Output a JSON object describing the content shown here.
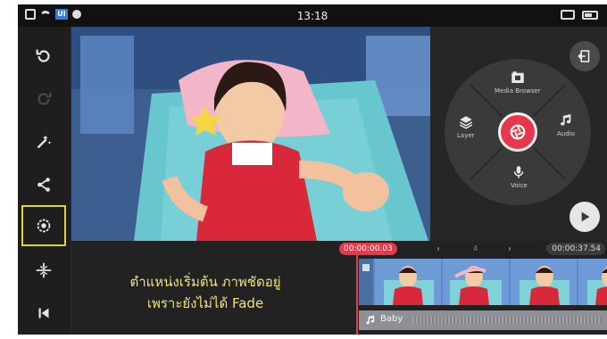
{
  "status_bar": {
    "time": "13:18",
    "badge": "UI",
    "left_icons": [
      "notification-icon",
      "wifi-icon",
      "app-badge-icon",
      "location-pin-icon"
    ],
    "right_icons": [
      "cast-icon",
      "battery-icon"
    ]
  },
  "toolbar": {
    "items": [
      {
        "name": "undo",
        "icon": "undo-icon",
        "enabled": true
      },
      {
        "name": "redo",
        "icon": "redo-icon",
        "enabled": false
      },
      {
        "name": "effects",
        "icon": "magic-wand-icon",
        "enabled": true
      },
      {
        "name": "share",
        "icon": "share-icon",
        "enabled": true
      },
      {
        "name": "settings",
        "icon": "settings-icon",
        "enabled": true,
        "selected": true
      },
      {
        "name": "split",
        "icon": "split-icon",
        "enabled": true
      },
      {
        "name": "jump-to-start",
        "icon": "skip-to-start-icon",
        "enabled": true
      }
    ],
    "selected_color": "#e0d23a"
  },
  "wheel_menu": {
    "media_browser": "Media Browser",
    "layer": "Layer",
    "audio": "Audio",
    "voice": "Voice",
    "record_color": "#e8364a"
  },
  "timeline": {
    "current_time": "00:00:00.03",
    "end_time": "00:00:37.54",
    "ticks": [
      "4",
      "8"
    ],
    "audio_label": "Baby",
    "caption": {
      "line1": "ตำแหน่งเริ่มต้น ภาพชัดอยู่",
      "line2": "เพราะยังไม่ได้ Fade"
    },
    "caption_color": "#efe27a",
    "accent": "#e6394a"
  }
}
